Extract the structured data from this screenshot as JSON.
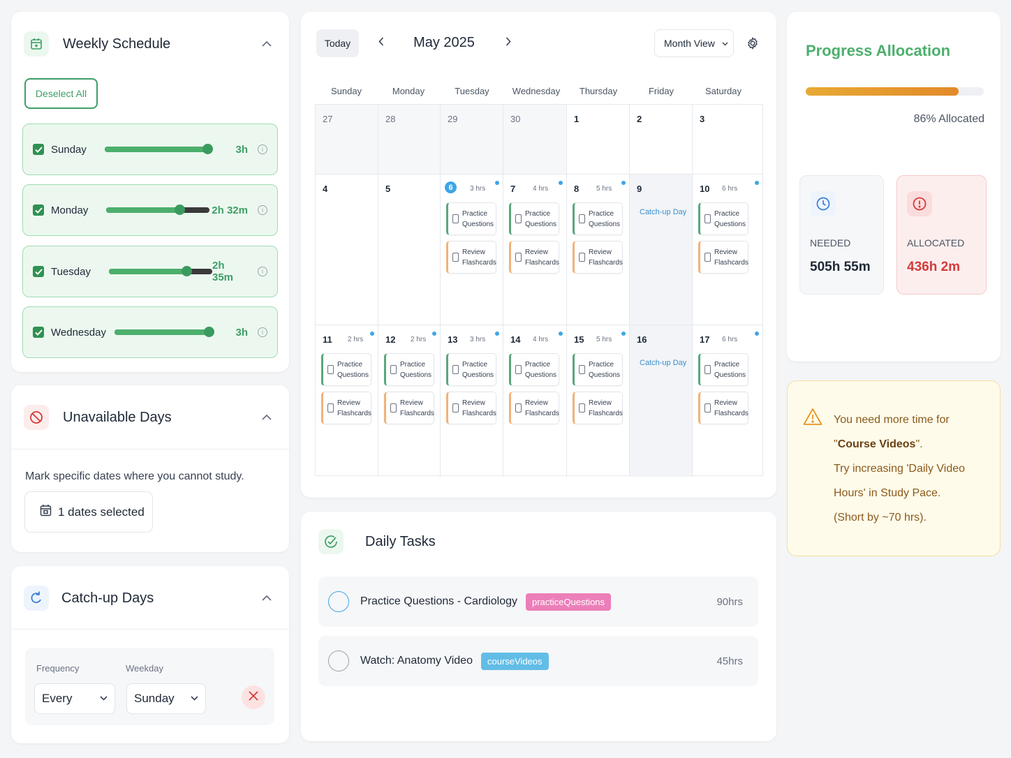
{
  "weekly_schedule": {
    "title": "Weekly Schedule",
    "deselect_label": "Deselect All",
    "days": [
      {
        "name": "Sunday",
        "hours": "3h",
        "fraction": 1.0
      },
      {
        "name": "Monday",
        "hours": "2h 32m",
        "fraction": 0.71
      },
      {
        "name": "Tuesday",
        "hours": "2h 35m",
        "fraction": 0.75
      },
      {
        "name": "Wednesday",
        "hours": "3h",
        "fraction": 1.0
      }
    ]
  },
  "unavailable_days": {
    "title": "Unavailable Days",
    "description": "Mark specific dates where you cannot study.",
    "dates_button": "1 dates selected"
  },
  "catchup_days": {
    "title": "Catch-up Days",
    "frequency_label": "Frequency",
    "frequency_value": "Every",
    "weekday_label": "Weekday",
    "weekday_value": "Sunday"
  },
  "calendar": {
    "today_label": "Today",
    "month_label": "May 2025",
    "view_label": "Month View",
    "weekdays": [
      "Sunday",
      "Monday",
      "Tuesday",
      "Wednesday",
      "Thursday",
      "Friday",
      "Saturday"
    ],
    "task_practice": "Practice Questions",
    "task_review": "Review Flashcards",
    "catchup_label": "Catch-up Day",
    "weeks": [
      [
        {
          "day": "27",
          "muted": true
        },
        {
          "day": "28",
          "muted": true
        },
        {
          "day": "29",
          "muted": true
        },
        {
          "day": "30",
          "muted": true
        },
        {
          "day": "1"
        },
        {
          "day": "2"
        },
        {
          "day": "3"
        }
      ],
      [
        {
          "day": "4"
        },
        {
          "day": "5"
        },
        {
          "day": "6",
          "today": true,
          "hours": "3 hrs",
          "tasks": true
        },
        {
          "day": "7",
          "hours": "4 hrs",
          "tasks": true
        },
        {
          "day": "8",
          "hours": "5 hrs",
          "tasks": true
        },
        {
          "day": "9",
          "catchup": true
        },
        {
          "day": "10",
          "hours": "6 hrs",
          "tasks": true
        }
      ],
      [
        {
          "day": "11",
          "hours": "2 hrs",
          "tasks": true
        },
        {
          "day": "12",
          "hours": "2 hrs",
          "tasks": true
        },
        {
          "day": "13",
          "hours": "3 hrs",
          "tasks": true
        },
        {
          "day": "14",
          "hours": "4 hrs",
          "tasks": true
        },
        {
          "day": "15",
          "hours": "5 hrs",
          "tasks": true
        },
        {
          "day": "16",
          "catchup": true
        },
        {
          "day": "17",
          "hours": "6 hrs",
          "tasks": true
        }
      ]
    ]
  },
  "daily_tasks": {
    "title": "Daily Tasks",
    "items": [
      {
        "label": "Practice Questions - Cardiology",
        "tag": "practiceQuestions",
        "tag_color": "#ec7fb9",
        "minutes": "90hrs",
        "circle_color": "#3ea6e6"
      },
      {
        "label": "Watch: Anatomy Video",
        "tag": "courseVideos",
        "tag_color": "#62bde6",
        "minutes": "45hrs",
        "circle_color": "#9ca3af"
      }
    ]
  },
  "progress": {
    "title": "Progress Allocation",
    "percent": 86,
    "percent_label": "86% Allocated",
    "needed_label": "NEEDED",
    "needed_value": "505h 55m",
    "allocated_label": "ALLOCATED",
    "allocated_value": "436h 2m"
  },
  "warning": {
    "line1": "You need more time for",
    "line2_quote_open": "\"",
    "line2_bold": "Course Videos",
    "line2_quote_close": "\".",
    "line3": "Try increasing 'Daily Video Hours' in Study Pace.",
    "line4": "(Short by ~70 hrs)."
  },
  "colors": {
    "green": "#3f9e68",
    "red": "#d33b3b",
    "blue": "#3ea6e6",
    "warn": "#e8951f"
  }
}
